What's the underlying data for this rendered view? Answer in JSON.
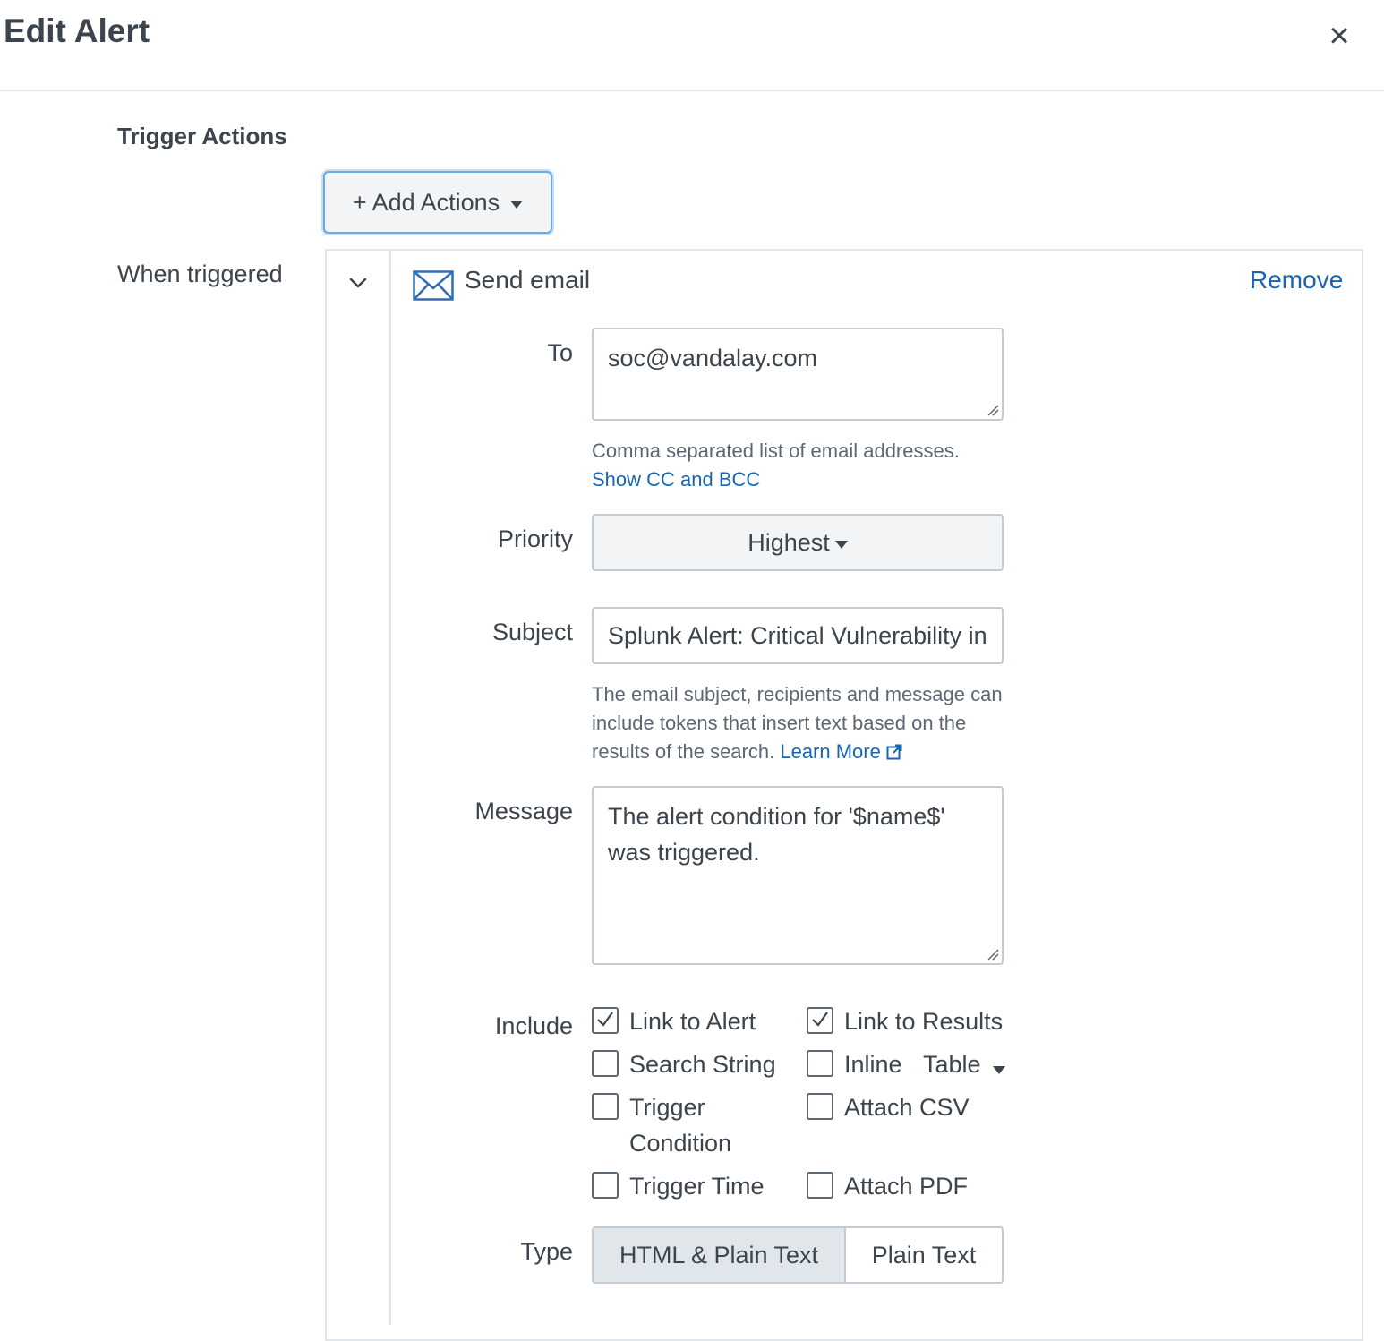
{
  "dialog": {
    "title": "Edit Alert",
    "close_label": "×"
  },
  "trigger_actions": {
    "section_title": "Trigger Actions",
    "add_actions_label": "+ Add Actions",
    "when_triggered_label": "When triggered"
  },
  "action": {
    "name": "Send email",
    "icon": "envelope-icon",
    "remove_label": "Remove"
  },
  "form": {
    "to_label": "To",
    "to_value": "soc@vandalay.com",
    "to_help": "Comma separated list of email addresses.",
    "show_cc_bcc": "Show CC and BCC",
    "priority_label": "Priority",
    "priority_value": "Highest",
    "subject_label": "Subject",
    "subject_value": "Splunk Alert: Critical Vulnerability in",
    "subject_help": "The email subject, recipients and message can include tokens that insert text based on the results of the search.",
    "learn_more": "Learn More",
    "message_label": "Message",
    "message_value": "The alert condition for '$name$' was triggered.",
    "include_label": "Include",
    "include_options": {
      "link_to_alert": {
        "label": "Link to Alert",
        "checked": true
      },
      "link_to_results": {
        "label": "Link to Results",
        "checked": true
      },
      "search_string": {
        "label": "Search String",
        "checked": false
      },
      "inline": {
        "label": "Inline",
        "checked": false
      },
      "inline_format": "Table",
      "trigger_condition_line1": "Trigger",
      "trigger_condition_line2": "Condition",
      "trigger_condition_checked": false,
      "attach_csv": {
        "label": "Attach CSV",
        "checked": false
      },
      "trigger_time": {
        "label": "Trigger Time",
        "checked": false
      },
      "attach_pdf": {
        "label": "Attach PDF",
        "checked": false
      }
    },
    "type_label": "Type",
    "type_options": [
      "HTML & Plain Text",
      "Plain Text"
    ],
    "type_selected": "HTML & Plain Text"
  },
  "colors": {
    "link": "#1a65b0",
    "text": "#3c444d",
    "border": "#c3cbd4",
    "focus": "#6ba9e6"
  }
}
